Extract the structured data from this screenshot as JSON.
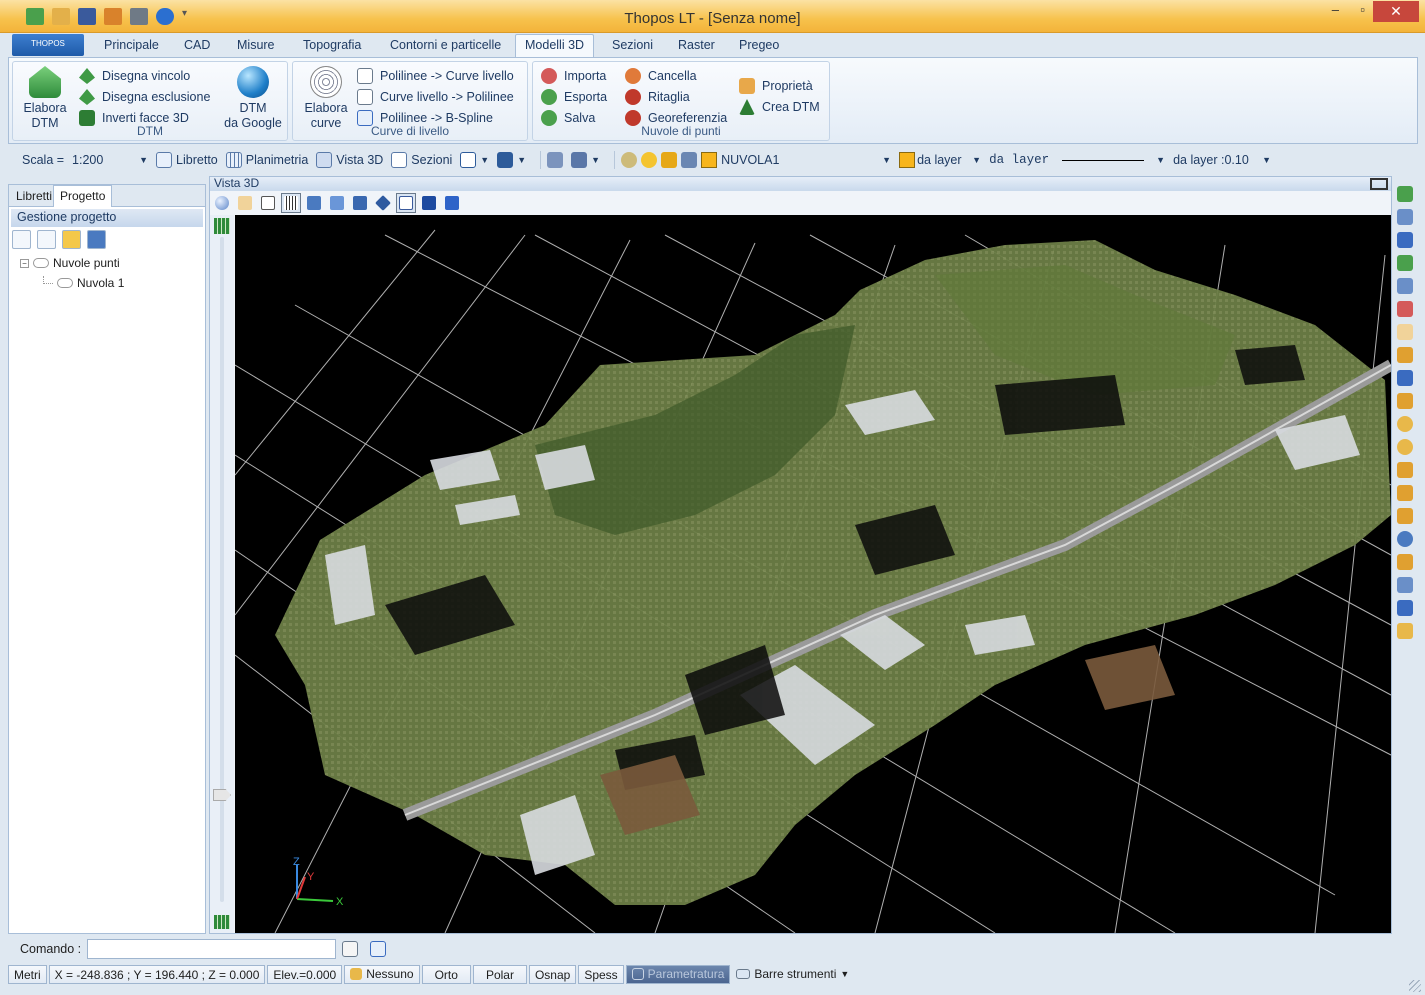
{
  "window": {
    "title": "Thopos LT - [Senza nome]",
    "minimize": "‒",
    "maximize": "▫",
    "close": "✕"
  },
  "app_button": {
    "label": "THOPOS"
  },
  "ribbon_tabs": [
    "Principale",
    "CAD",
    "Misure",
    "Topografia",
    "Contorni e particelle",
    "Modelli 3D",
    "Sezioni",
    "Raster",
    "Pregeo"
  ],
  "active_tab": "Modelli 3D",
  "ribbon": {
    "dtm": {
      "title": "DTM",
      "elabora_dtm_1": "Elabora",
      "elabora_dtm_2": "DTM",
      "disegna_vincolo": "Disegna vincolo",
      "disegna_esclusione": "Disegna esclusione",
      "inverti_facce": "Inverti facce 3D",
      "dtm_google_1": "DTM",
      "dtm_google_2": "da Google"
    },
    "curve": {
      "title": "Curve di livello",
      "elabora_curve_1": "Elabora",
      "elabora_curve_2": "curve",
      "poly_to_curve": "Polilinee -> Curve livello",
      "curve_to_poly": "Curve livello -> Polilinee",
      "poly_to_bspline": "Polilinee -> B-Spline"
    },
    "nuvole": {
      "title": "Nuvole di punti",
      "importa": "Importa",
      "esporta": "Esporta",
      "salva": "Salva",
      "cancella": "Cancella",
      "ritaglia": "Ritaglia",
      "georeferenzia": "Georeferenzia",
      "proprieta": "Proprietà",
      "crea_dtm": "Crea DTM"
    }
  },
  "toolbar": {
    "scala_label": "Scala =",
    "scala_value": "1:200",
    "libretto": "Libretto",
    "planimetria": "Planimetria",
    "vista3d": "Vista 3D",
    "sezioni": "Sezioni",
    "layer_name": "NUVOLA1",
    "color_layer": "da layer",
    "linetype": "da layer",
    "lineweight": "da layer :0.10",
    "layer_color": "#f7b51c"
  },
  "left_panel": {
    "tabs": [
      "Libretti",
      "Progetto"
    ],
    "header": "Gestione progetto",
    "tree": {
      "root": "Nuvole punti",
      "child": "Nuvola 1"
    }
  },
  "view": {
    "title": "Vista 3D",
    "axes": {
      "z": "Z",
      "y": "Y",
      "x": "X"
    }
  },
  "command": {
    "label": "Comando :",
    "value": ""
  },
  "status": {
    "units": "Metri",
    "coords": "X = -248.836 ; Y = 196.440 ; Z = 0.000",
    "elev": "Elev.=0.000",
    "snap": "Nessuno",
    "orto": "Orto",
    "polar": "Polar",
    "osnap": "Osnap",
    "spess": "Spess",
    "parametratura": "Parametratura",
    "barre": "Barre strumenti"
  },
  "colors": {
    "accent": "#f3b33a",
    "brand": "#1e5aa8",
    "close": "#c7473c"
  }
}
